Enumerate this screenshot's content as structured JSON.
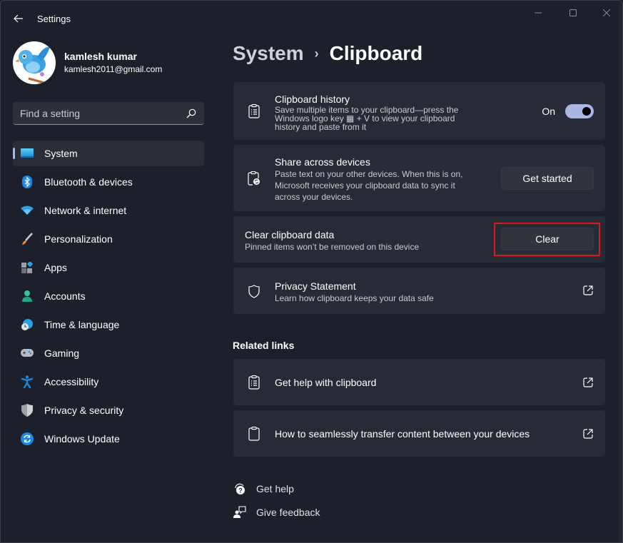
{
  "window": {
    "title": "Settings",
    "controls": {
      "minimize": "minimize",
      "maximize": "maximize",
      "close": "close"
    }
  },
  "profile": {
    "name": "kamlesh kumar",
    "email": "kamlesh2011@gmail.com"
  },
  "search": {
    "placeholder": "Find a setting",
    "value": ""
  },
  "sidebar": {
    "items": [
      {
        "label": "System",
        "icon": "system-display-icon",
        "active": true
      },
      {
        "label": "Bluetooth & devices",
        "icon": "bluetooth-icon"
      },
      {
        "label": "Network & internet",
        "icon": "wifi-icon"
      },
      {
        "label": "Personalization",
        "icon": "paintbrush-icon"
      },
      {
        "label": "Apps",
        "icon": "apps-icon"
      },
      {
        "label": "Accounts",
        "icon": "person-icon"
      },
      {
        "label": "Time & language",
        "icon": "globe-clock-icon"
      },
      {
        "label": "Gaming",
        "icon": "gamepad-icon"
      },
      {
        "label": "Accessibility",
        "icon": "accessibility-icon"
      },
      {
        "label": "Privacy & security",
        "icon": "shield-icon"
      },
      {
        "label": "Windows Update",
        "icon": "update-icon"
      }
    ]
  },
  "breadcrumb": {
    "parent": "System",
    "separator": "›",
    "current": "Clipboard"
  },
  "cards": {
    "history": {
      "title": "Clipboard history",
      "desc_lines": [
        "Save multiple items to your clipboard—press the",
        "Windows logo key ▦ + V to view your clipboard",
        "history and paste from it"
      ],
      "toggle_label": "On",
      "toggle_on": true
    },
    "share": {
      "title": "Share across devices",
      "desc_lines": [
        "Paste text on your other devices. When this is on,",
        "Microsoft receives your clipboard data to sync it",
        "across your devices."
      ],
      "button": "Get started"
    },
    "clear": {
      "title": "Clear clipboard data",
      "desc": "Pinned items won’t be removed on this device",
      "button": "Clear"
    },
    "privacy": {
      "title": "Privacy Statement",
      "desc": "Learn how clipboard keeps your data safe"
    }
  },
  "related": {
    "title": "Related links",
    "links": [
      {
        "label": "Get help with clipboard"
      },
      {
        "label": "How to seamlessly transfer content between your devices"
      }
    ]
  },
  "footer": {
    "help": "Get help",
    "feedback": "Give feedback"
  },
  "colors": {
    "accent": "#a8b8e2",
    "highlight_border": "#e0141b",
    "card_bg": "#272b35",
    "window_bg": "#1c202a"
  }
}
